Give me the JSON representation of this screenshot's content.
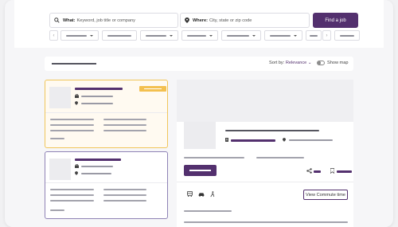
{
  "search": {
    "what_label": "What:",
    "what_placeholder": "Keyword, job title or company",
    "where_label": "Where:",
    "where_placeholder": "City, state or zip code",
    "find_button": "Find a job"
  },
  "results": {
    "sort_label": "Sort by:",
    "sort_value": "Relevance",
    "show_map": "Show map"
  },
  "detail": {
    "commute_button": "View Commute time"
  },
  "colors": {
    "brand": "#53306e",
    "highlight": "#f3c04f",
    "selected_border": "#8e82b5"
  },
  "icons": [
    "search-icon",
    "map-pin-icon",
    "chevron-down-icon",
    "briefcase-icon",
    "building-icon",
    "share-icon",
    "bookmark-icon",
    "bus-icon",
    "car-icon",
    "walk-icon"
  ]
}
